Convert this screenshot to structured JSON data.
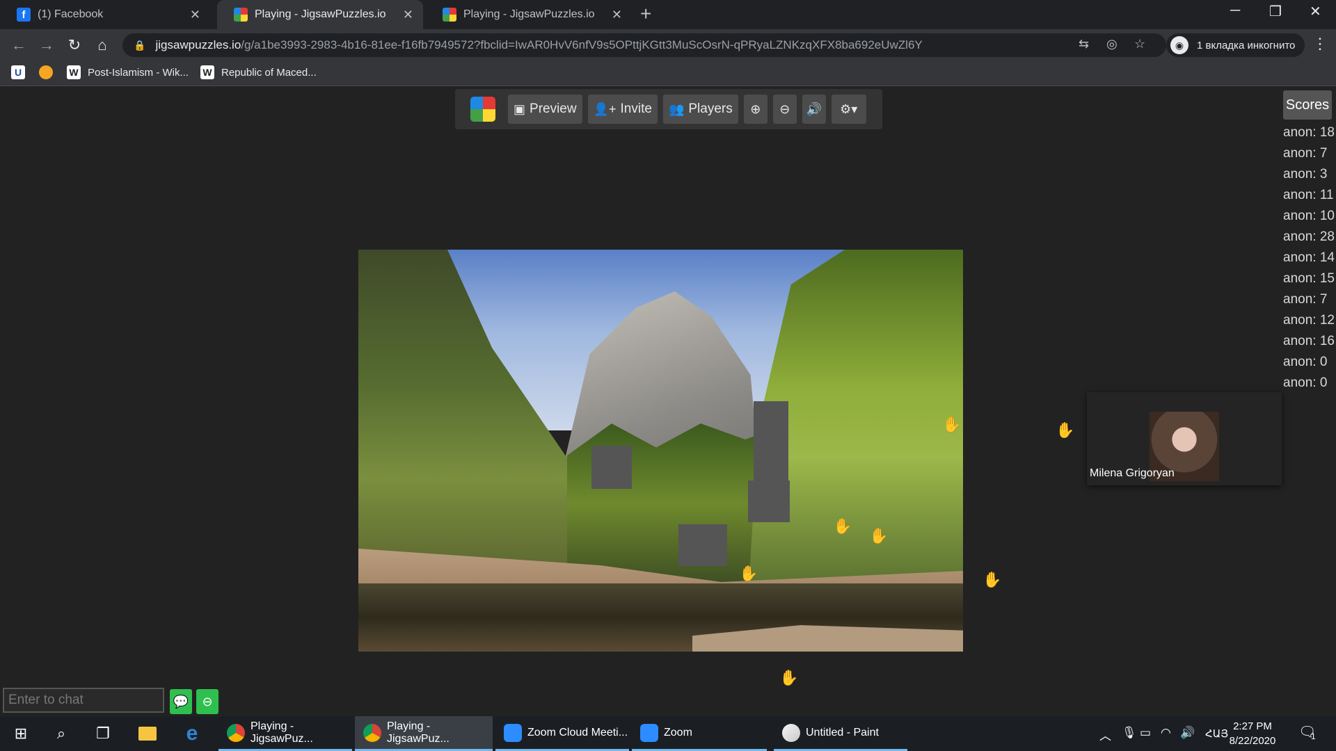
{
  "browser": {
    "tabs": [
      {
        "label": "(1) Facebook",
        "fav": "facebook-icon"
      },
      {
        "label": "Playing - JigsawPuzzles.io",
        "fav": "jigsaw-icon"
      },
      {
        "label": "Playing - JigsawPuzzles.io",
        "fav": "jigsaw-icon"
      }
    ],
    "url_host": "jigsawpuzzles.io",
    "url_path": "/g/a1be3993-2983-4b16-81ee-f16fb7949572?fbclid=IwAR0HvV6nfV9s5OPttjKGtt3MuScOsrN-qPRyaLZNKzqXFX8ba692eUwZl6Y",
    "incognito_label": "1 вкладка инкогнито",
    "bookmarks": [
      {
        "label": "",
        "icon": "u-icon"
      },
      {
        "label": "",
        "icon": "orange-circle-icon"
      },
      {
        "label": "Post-Islamism - Wik...",
        "icon": "wikipedia-icon"
      },
      {
        "label": "Republic of Maced...",
        "icon": "wikipedia-icon"
      }
    ]
  },
  "game": {
    "toolbar": {
      "preview_label": "Preview",
      "invite_label": "Invite",
      "players_label": "Players"
    },
    "scores_label": "Scores",
    "scores": [
      "anon: 18",
      "anon: 7",
      "anon: 3",
      "anon: 11",
      "anon: 10",
      "anon: 28",
      "anon: 14",
      "anon: 15",
      "anon: 7",
      "anon: 12",
      "anon: 16",
      "anon: 0",
      "anon: 0"
    ],
    "video_participant": "Milena Grigoryan",
    "chat_placeholder": "Enter to chat"
  },
  "taskbar": {
    "apps": [
      {
        "label": "Playing - JigsawPuz...",
        "icon": "chrome-icon"
      },
      {
        "label": "Playing - JigsawPuz...",
        "icon": "chrome-icon"
      },
      {
        "label": "Zoom Cloud Meeti...",
        "icon": "zoom-icon"
      },
      {
        "label": "Zoom",
        "icon": "zoom-icon"
      },
      {
        "label": "Untitled - Paint",
        "icon": "paint-icon"
      }
    ],
    "language": "ՀԱՅ",
    "time": "2:27 PM",
    "date": "8/22/2020",
    "notification_count": "1"
  },
  "colors": {
    "chrome_dark": "#202124",
    "chrome_toolbar": "#35363a",
    "page_bg": "#222222",
    "chat_accent": "#2fbf4f",
    "taskbar_highlight": "#76b9ed"
  }
}
